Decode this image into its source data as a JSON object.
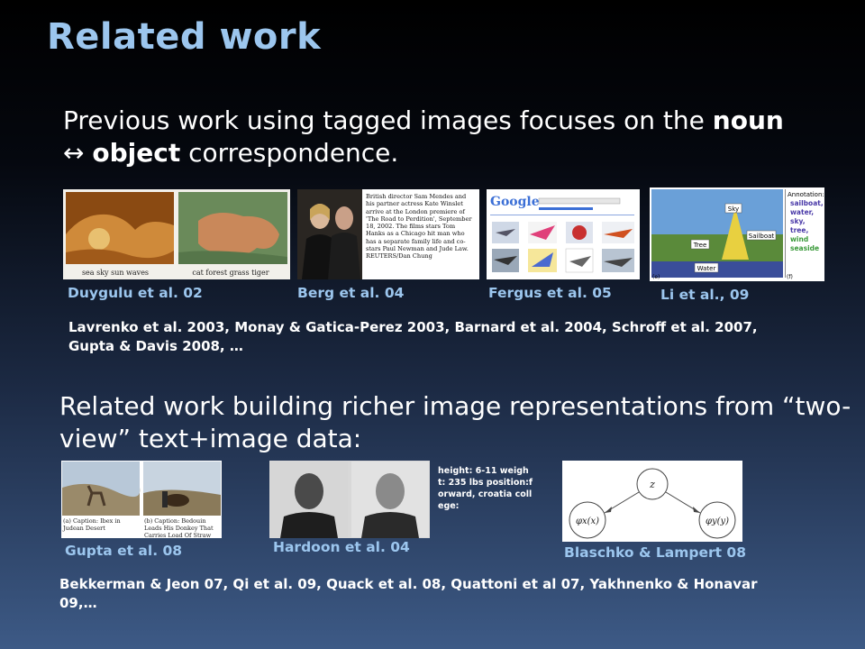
{
  "title": "Related work",
  "section1": {
    "pre": "Previous work using tagged images focuses on the ",
    "noun": "noun",
    "arrow": " ↔ ",
    "object": "object",
    "post": " correspondence."
  },
  "images1": {
    "duygulu": {
      "caption": "Duygulu et al. 02",
      "words_left": "sea sky sun waves",
      "words_right": "cat forest grass tiger"
    },
    "berg": {
      "caption": "Berg et al. 04",
      "text": "British director Sam Mendes and his partner actress Kate Winslet arrive at the London premiere of 'The Road to Perdition', September 18, 2002. The films stars Tom Hanks as a Chicago hit man who has a separate family life and co-stars Paul Newman and Jude Law. REUTERS/Dan Chung"
    },
    "fergus": {
      "caption": "Fergus et al. 05",
      "logo": "Google"
    },
    "li": {
      "caption": "Li et al., 09",
      "labels": [
        "Sky",
        "Tree",
        "Sailboat",
        "Water"
      ],
      "annotation_title": "Annotation:",
      "annotation_words": [
        "sailboat,",
        "water,",
        "sky,",
        "tree,",
        "wind",
        "seaside"
      ],
      "corner_left": "(e)",
      "corner_right": "(f)"
    }
  },
  "refs1": "Lavrenko et al. 2003, Monay & Gatica-Perez 2003, Barnard et al. 2004, Schroff et al. 2007, Gupta & Davis 2008, …",
  "section2": "Related work building richer image representations from “two-view” text+image data:",
  "images2": {
    "gupta": {
      "caption": "Gupta et al. 08",
      "cap_a": "(a) Caption: Ibex in Judean Desert",
      "cap_b": "(b) Caption: Bedouin Leads His Donkey That Carries Load Of Straw"
    },
    "hardoon": {
      "caption": "Hardoon et al. 04",
      "note": "height: 6-11 weight: 235 lbs position:forward, croatia college:"
    },
    "blaschko": {
      "caption": "Blaschko & Lampert 08",
      "node_z": "z",
      "node_x": "φx(x)",
      "node_y": "φy(y)"
    }
  },
  "refs2": "Bekkerman & Jeon 07, Qi et al. 09, Quack et al. 08, Quattoni et al 07, Yakhnenko & Honavar 09,…"
}
